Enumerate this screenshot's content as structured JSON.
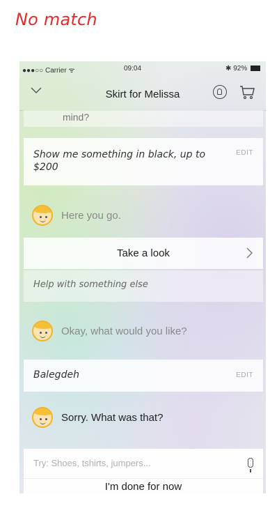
{
  "caption": "No match",
  "status_bar": {
    "carrier": "●●●○○ Carrier ",
    "wifi_glyph": "ᯤ",
    "time": "09:04",
    "battery": "✱ 92%"
  },
  "nav": {
    "title": "Skirt for Melissa",
    "back_icon": "chevron-down-icon",
    "bell_icon": "bell-icon",
    "cart_icon": "cart-icon"
  },
  "conversation": {
    "partial_text": "mind?",
    "user_message_1": "Show me something in black, up to $200",
    "edit_label": "EDIT",
    "bot_reply_1": "Here you go.",
    "take_look_label": "Take a look",
    "help_label": "Help with something else",
    "bot_reply_2": "Okay, what would you like?",
    "user_message_2": "Balegdeh",
    "bot_reply_3": "Sorry. What was that?"
  },
  "input": {
    "placeholder": "Try: Shoes, tshirts, jumpers..."
  },
  "done_label": "I'm done for now",
  "colors": {
    "caption": "#e42a2a",
    "avatar_hair": "#f5bf38"
  }
}
